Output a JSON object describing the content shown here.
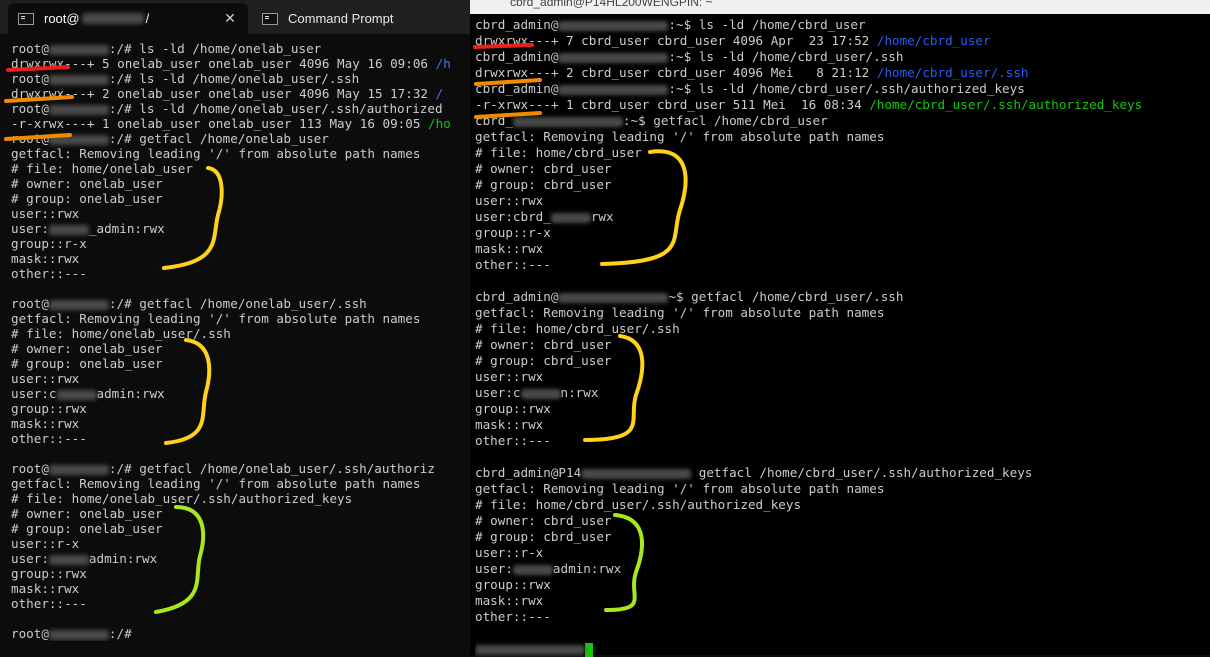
{
  "left_window": {
    "tabs": [
      {
        "label": "root@",
        "suffix": " /",
        "active": true
      },
      {
        "label": "Command Prompt",
        "active": false
      }
    ],
    "close_glyph": "✕",
    "lines": [
      {
        "prompt": "root@",
        "path": ":/# ",
        "cmd": "ls -ld /home/onelab_user"
      },
      {
        "text": "drwxrwx---+ 5 onelab_user onelab_user 4096 May 16 09:06 ",
        "tail": "/h",
        "tail_color": "blue"
      },
      {
        "prompt": "root@",
        "path": ":/# ",
        "cmd": "ls -ld /home/onelab_user/.ssh"
      },
      {
        "text": "drwxrwx---+ 2 onelab_user onelab_user 4096 May 15 17:32 ",
        "tail": "/",
        "tail_color": "blue"
      },
      {
        "prompt": "root@",
        "path": ":/# ",
        "cmd": "ls -ld /home/onelab_user/.ssh/authorized"
      },
      {
        "text": "-r-xrwx---+ 1 onelab_user onelab_user 113 May 16 09:05 ",
        "tail": "/ho",
        "tail_color": "green"
      },
      {
        "prompt": "root@",
        "path": ":/# ",
        "cmd": "getfacl /home/onelab_user"
      },
      {
        "text": "getfacl: Removing leading '/' from absolute path names"
      },
      {
        "text": "# file: home/onelab_user"
      },
      {
        "text": "# owner: onelab_user"
      },
      {
        "text": "# group: onelab_user"
      },
      {
        "text": "user::rwx"
      },
      {
        "text": "user:",
        "after": "_admin:rwx"
      },
      {
        "text": "group::r-x"
      },
      {
        "text": "mask::rwx"
      },
      {
        "text": "other::---"
      },
      {
        "gap": true
      },
      {
        "prompt": "root@",
        "path": ":/# ",
        "cmd": "getfacl /home/onelab_user/.ssh"
      },
      {
        "text": "getfacl: Removing leading '/' from absolute path names"
      },
      {
        "text": "# file: home/onelab_user/.ssh"
      },
      {
        "text": "# owner: onelab_user"
      },
      {
        "text": "# group: onelab_user"
      },
      {
        "text": "user::rwx"
      },
      {
        "text": "user:c",
        "after": "admin:rwx"
      },
      {
        "text": "group::rwx"
      },
      {
        "text": "mask::rwx"
      },
      {
        "text": "other::---"
      },
      {
        "gap": true
      },
      {
        "prompt": "root@",
        "path": ":/# ",
        "cmd": "getfacl /home/onelab_user/.ssh/authoriz"
      },
      {
        "text": "getfacl: Removing leading '/' from absolute path names"
      },
      {
        "text": "# file: home/onelab_user/.ssh/authorized_keys"
      },
      {
        "text": "# owner: onelab_user"
      },
      {
        "text": "# group: onelab_user"
      },
      {
        "text": "user::r-x"
      },
      {
        "text": "user:",
        "after": "admin:rwx"
      },
      {
        "text": "group::rwx"
      },
      {
        "text": "mask::rwx"
      },
      {
        "text": "other::---"
      },
      {
        "gap": true
      },
      {
        "prompt": "root@",
        "path": ":/# ",
        "cmd": ""
      }
    ]
  },
  "right_window": {
    "title": "cbrd_admin@P14HL200WENGPIN: ~",
    "lines": [
      {
        "prompt": "cbrd_admin@",
        "path": ":~$ ",
        "cmd": "ls -ld /home/cbrd_user"
      },
      {
        "text": "drwxrwx---+ 7 cbrd_user cbrd_user 4096 Apr  23 17:52 ",
        "tail": "/home/cbrd_user",
        "tail_color": "blue"
      },
      {
        "prompt": "cbrd_admin@",
        "path": ":~$ ",
        "cmd": "ls -ld /home/cbrd_user/.ssh"
      },
      {
        "text": "drwxrwx---+ 2 cbrd_user cbrd_user 4096 Mei   8 21:12 ",
        "tail": "/home/cbrd_user/.ssh",
        "tail_color": "blue"
      },
      {
        "prompt": "cbrd_admin@",
        "path": ":~$ ",
        "cmd": "ls -ld /home/cbrd_user/.ssh/authorized_keys"
      },
      {
        "text": "-r-xrwx---+ 1 cbrd_user cbrd_user 511 Mei  16 08:34 ",
        "tail": "/home/cbrd_user/.ssh/authorized_keys",
        "tail_color": "green"
      },
      {
        "prompt": "cbrd_",
        "path": ":~$ ",
        "cmd": "getfacl /home/cbrd_user"
      },
      {
        "text": "getfacl: Removing leading '/' from absolute path names"
      },
      {
        "text": "# file: home/cbrd_user"
      },
      {
        "text": "# owner: cbrd_user"
      },
      {
        "text": "# group: cbrd_user"
      },
      {
        "text": "user::rwx"
      },
      {
        "text": "user:cbrd_",
        "after": "rwx"
      },
      {
        "text": "group::r-x"
      },
      {
        "text": "mask::rwx"
      },
      {
        "text": "other::---"
      },
      {
        "gap": true
      },
      {
        "prompt": "cbrd_admin@",
        "path": "~$ ",
        "cmd": "getfacl /home/cbrd_user/.ssh"
      },
      {
        "text": "getfacl: Removing leading '/' from absolute path names"
      },
      {
        "text": "# file: home/cbrd_user/.ssh"
      },
      {
        "text": "# owner: cbrd_user"
      },
      {
        "text": "# group: cbrd_user"
      },
      {
        "text": "user::rwx"
      },
      {
        "text": "user:c",
        "after": "n:rwx"
      },
      {
        "text": "group::rwx"
      },
      {
        "text": "mask::rwx"
      },
      {
        "text": "other::---"
      },
      {
        "gap": true
      },
      {
        "prompt": "cbrd_admin@P14",
        "path": " ",
        "cmd": "getfacl /home/cbrd_user/.ssh/authorized_keys"
      },
      {
        "text": "getfacl: Removing leading '/' from absolute path names"
      },
      {
        "text": "# file: home/cbrd_user/.ssh/authorized_keys"
      },
      {
        "text": "# owner: cbrd_user"
      },
      {
        "text": "# group: cbrd_user"
      },
      {
        "text": "user::r-x"
      },
      {
        "text": "user:",
        "after": "admin:rwx"
      },
      {
        "text": "group::rwx"
      },
      {
        "text": "mask::rwx"
      },
      {
        "text": "other::---"
      },
      {
        "gap": true
      },
      {
        "prompt": "",
        "path": "",
        "cmd": "",
        "cursor": true
      }
    ]
  },
  "annotation_colors": {
    "red": "#e8211a",
    "orange": "#f28a00",
    "yellow": "#ffd21a",
    "lime": "#a8e61d"
  }
}
